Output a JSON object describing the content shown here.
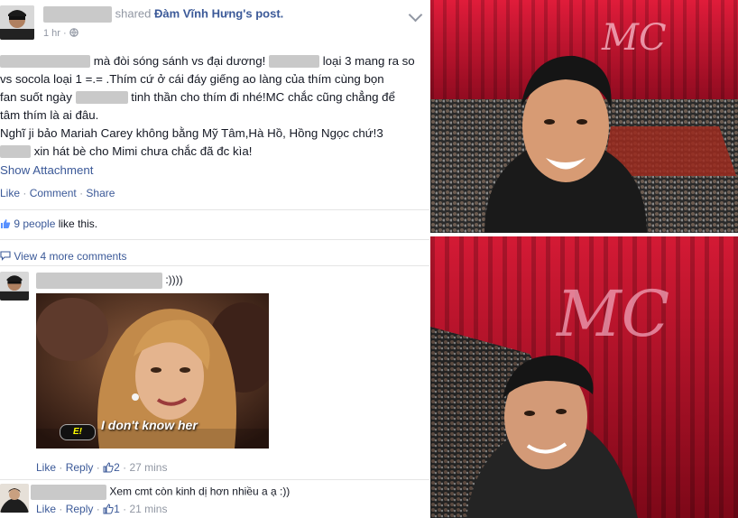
{
  "post": {
    "shared_verb": "shared",
    "original_author": "Đàm Vĩnh Hưng",
    "possessive": "'s",
    "post_word": "post.",
    "timestamp": "1 hr",
    "meta_sep": "·",
    "lines": {
      "l1_mid": "mà đòi sóng sánh vs đại dương!",
      "l1_end": "loại 3 mang ra so",
      "l2": "vs socola loại 1 =.= .Thím cứ ở cái đáy giếng ao làng của thím cùng bọn",
      "l3_start": "fan suốt ngày",
      "l3_end": "tinh thần cho thím đi nhé!MC chắc cũng chẳng để",
      "l4": "tâm thím là ai đâu.",
      "l5": "Nghĩ ji bảo Mariah Carey không bằng Mỹ Tâm,Hà Hồ, Hồng Ngọc chứ!3",
      "l6_end": "xin hát bè cho Mimi chưa chắc đã đc kìa!"
    },
    "show_attachment": "Show Attachment",
    "actions": {
      "like": "Like",
      "comment": "Comment",
      "share": "Share",
      "sep": "·"
    },
    "likes": {
      "count_text": "9 people",
      "suffix": " like this."
    },
    "view_more": "View 4 more comments"
  },
  "comments": [
    {
      "text": ":))))",
      "gif_caption": "I don't know her",
      "gif_watermark": "E!",
      "actions": {
        "like": "Like",
        "reply": "Reply",
        "likes": "2",
        "time": "27 mins"
      }
    },
    {
      "text": "Xem cmt còn kinh dị hơn nhiều a ạ :))",
      "actions": {
        "like": "Like",
        "reply": "Reply",
        "likes": "1",
        "time": "21 mins"
      }
    }
  ],
  "colors": {
    "link": "#3b5998",
    "muted": "#9197a3",
    "text": "#141823",
    "stage_red": "#c8112e"
  },
  "icons": [
    "chevron-down-icon",
    "globe-icon",
    "thumbs-up-icon"
  ]
}
